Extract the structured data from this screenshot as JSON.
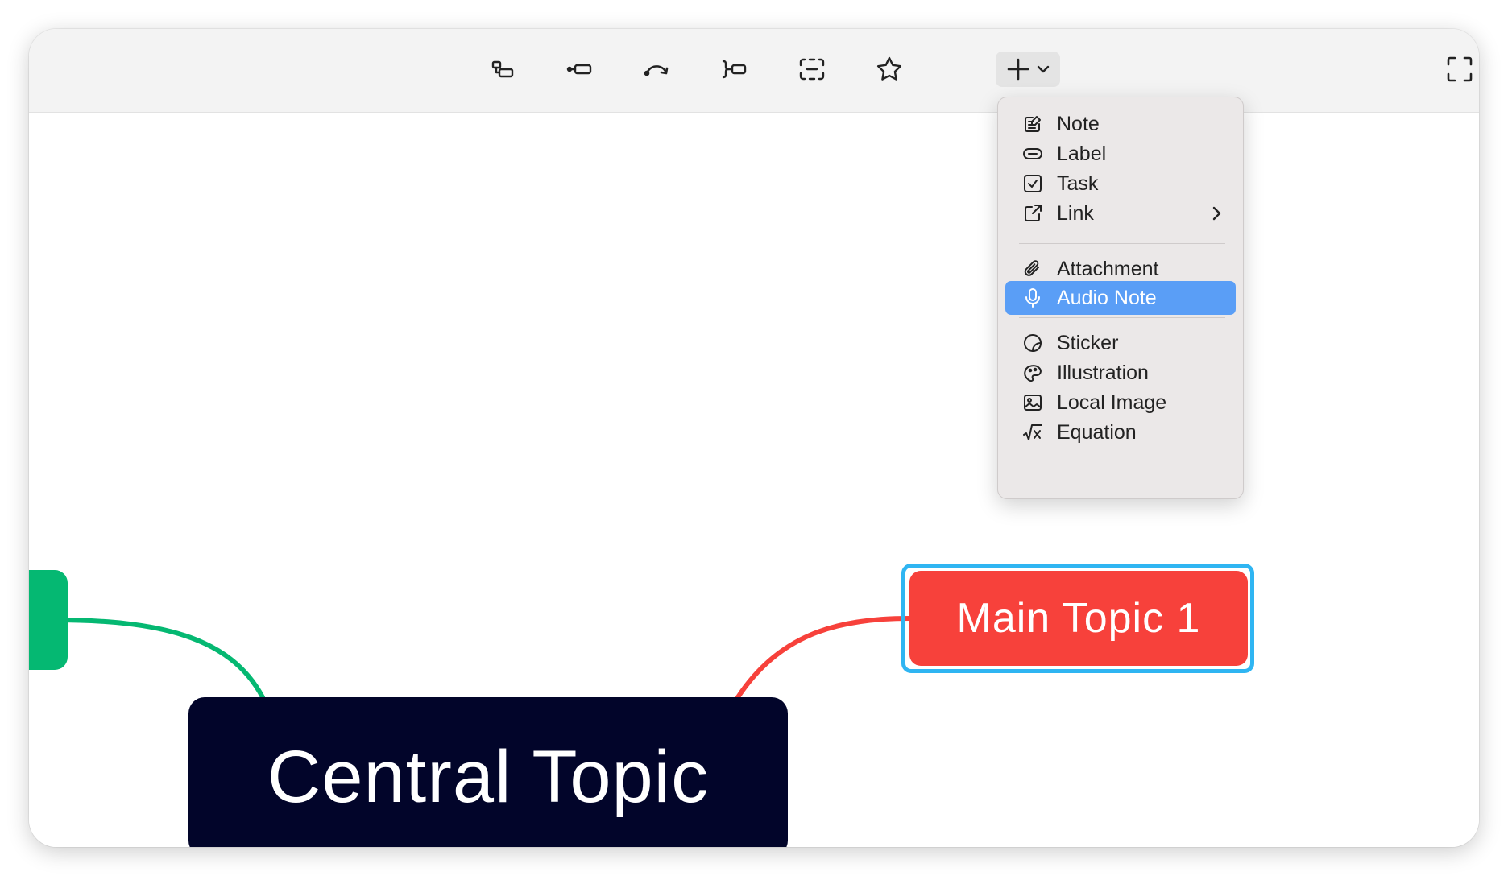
{
  "toolbar": {
    "tools": [
      {
        "icon": "subtopic-icon"
      },
      {
        "icon": "topic-icon"
      },
      {
        "icon": "relationship-icon"
      },
      {
        "icon": "summary-icon"
      },
      {
        "icon": "boundary-icon"
      },
      {
        "icon": "star-icon"
      }
    ],
    "insert_icon": "plus-icon",
    "fullscreen_icon": "fullscreen-icon"
  },
  "insert_menu": {
    "items": [
      {
        "label": "Note",
        "icon": "note-icon"
      },
      {
        "label": "Label",
        "icon": "label-icon"
      },
      {
        "label": "Task",
        "icon": "task-icon"
      },
      {
        "label": "Link",
        "icon": "link-icon",
        "has_submenu": true
      },
      {
        "label": "Attachment",
        "icon": "paperclip-icon"
      },
      {
        "label": "Audio Note",
        "icon": "microphone-icon",
        "highlighted": true
      },
      {
        "label": "Sticker",
        "icon": "sticker-icon"
      },
      {
        "label": "Illustration",
        "icon": "illustration-icon"
      },
      {
        "label": "Local Image",
        "icon": "image-icon"
      },
      {
        "label": "Equation",
        "icon": "equation-icon"
      }
    ]
  },
  "canvas": {
    "central_topic": "Central Topic",
    "main_topic_1": "Main Topic 1"
  },
  "colors": {
    "central": "#02052a",
    "main_topic": "#f7413b",
    "selection": "#2fb5f2",
    "green_branch": "#05b872",
    "yellow_branch": "#f2c418",
    "orange_branch": "#f59a45",
    "menu_highlight": "#5a9ef6"
  }
}
